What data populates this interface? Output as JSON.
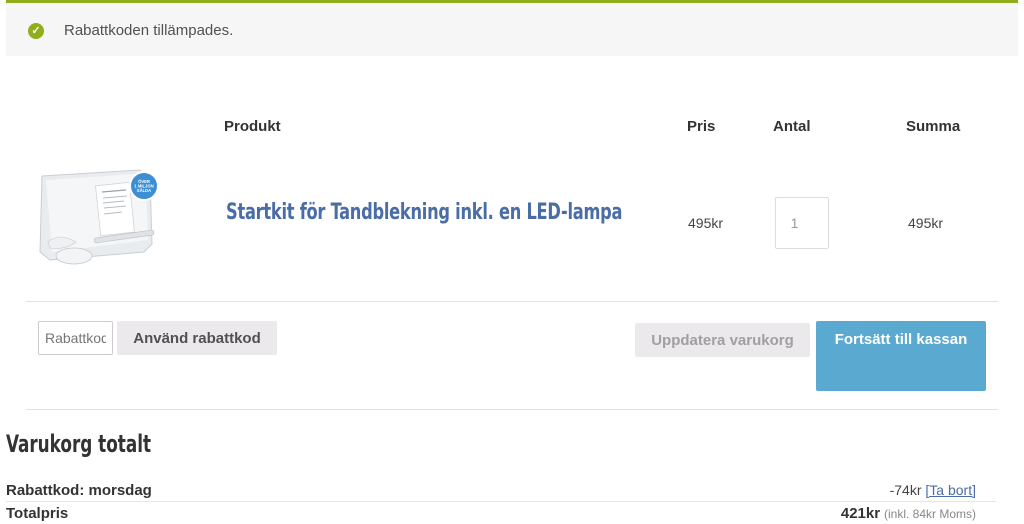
{
  "notice": {
    "message": "Rabattkoden tillämpades."
  },
  "cart": {
    "headers": {
      "product": "Produkt",
      "price": "Pris",
      "quantity": "Antal",
      "total": "Summa"
    },
    "item": {
      "name": "Startkit för Tandblekning inkl. en LED-lampa",
      "price": "495kr",
      "quantity": "1",
      "subtotal": "495kr",
      "badge_text": "ÖVER 1 MILJON SÅLDA"
    },
    "coupon": {
      "placeholder": "Rabattkod",
      "apply_label": "Använd rabattkod"
    },
    "update_label": "Uppdatera varukorg",
    "checkout_label": "Fortsätt till kassan"
  },
  "totals": {
    "title": "Varukorg totalt",
    "discount_label": "Rabattkod: morsdag",
    "discount_value": "-74kr",
    "remove_link": "[Ta bort]",
    "total_label": "Totalpris",
    "total_value": "421kr",
    "tax_note": "(inkl. 84kr Moms)"
  },
  "colors": {
    "accent_green": "#8fae1b",
    "checkout_blue": "#5aa9d1",
    "link_blue": "#4a6da7"
  }
}
